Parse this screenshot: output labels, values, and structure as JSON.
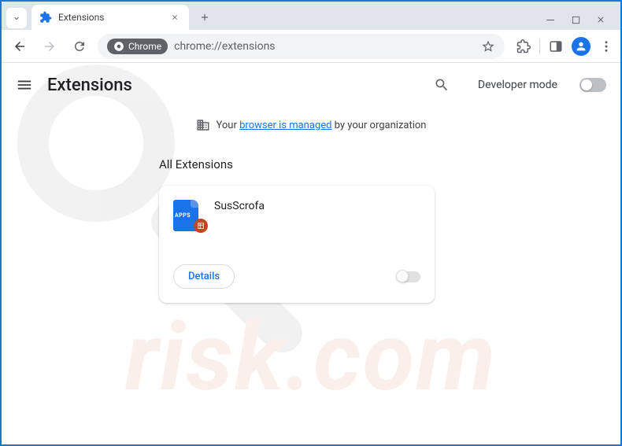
{
  "tab": {
    "title": "Extensions"
  },
  "address": {
    "chip_label": "Chrome",
    "url": "chrome://extensions"
  },
  "header": {
    "title": "Extensions",
    "dev_mode_label": "Developer mode"
  },
  "managed_banner": {
    "prefix": "Your ",
    "link": "browser is managed",
    "suffix": " by your organization"
  },
  "section": {
    "title": "All Extensions"
  },
  "extension": {
    "name": "SusScrofa",
    "icon_text": "APPS",
    "details_label": "Details"
  }
}
